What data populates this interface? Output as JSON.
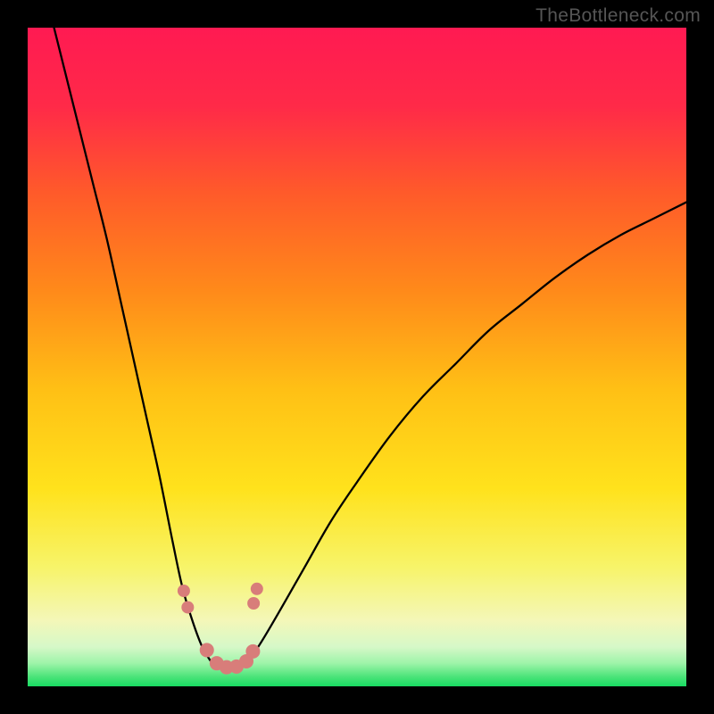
{
  "watermark": "TheBottleneck.com",
  "chart_data": {
    "type": "line",
    "title": "",
    "xlabel": "",
    "ylabel": "",
    "xlim": [
      0,
      100
    ],
    "ylim": [
      0,
      100
    ],
    "grid": false,
    "gradient": {
      "stops": [
        {
          "offset": 0.0,
          "color": "#ff1a52"
        },
        {
          "offset": 0.12,
          "color": "#ff2a48"
        },
        {
          "offset": 0.25,
          "color": "#ff5a2a"
        },
        {
          "offset": 0.4,
          "color": "#ff8a1a"
        },
        {
          "offset": 0.55,
          "color": "#ffc015"
        },
        {
          "offset": 0.7,
          "color": "#ffe21c"
        },
        {
          "offset": 0.82,
          "color": "#f7f46a"
        },
        {
          "offset": 0.9,
          "color": "#f4f7b8"
        },
        {
          "offset": 0.94,
          "color": "#d6f8c8"
        },
        {
          "offset": 0.965,
          "color": "#9ef4a9"
        },
        {
          "offset": 0.985,
          "color": "#4de47a"
        },
        {
          "offset": 1.0,
          "color": "#18db62"
        }
      ]
    },
    "series": [
      {
        "name": "left-branch",
        "x": [
          4,
          6,
          8,
          10,
          12,
          14,
          16,
          18,
          20,
          22,
          23.5,
          25,
          26.5,
          28
        ],
        "y": [
          100,
          92,
          84,
          76,
          68,
          59,
          50,
          41,
          32,
          22,
          15,
          10,
          6,
          3.5
        ]
      },
      {
        "name": "right-branch",
        "x": [
          33,
          35,
          38,
          42,
          46,
          50,
          55,
          60,
          65,
          70,
          75,
          80,
          85,
          90,
          95,
          100
        ],
        "y": [
          3.5,
          6,
          11,
          18,
          25,
          31,
          38,
          44,
          49,
          54,
          58,
          62,
          65.5,
          68.5,
          71,
          73.5
        ]
      },
      {
        "name": "valley-floor",
        "x": [
          28,
          29.5,
          31,
          32,
          33
        ],
        "y": [
          3.5,
          2.8,
          2.6,
          2.8,
          3.5
        ]
      }
    ],
    "markers": {
      "name": "valley-dots",
      "color": "#d87d7a",
      "points": [
        {
          "x": 23.7,
          "y": 14.5,
          "r": 7
        },
        {
          "x": 24.3,
          "y": 12.0,
          "r": 7
        },
        {
          "x": 27.2,
          "y": 5.5,
          "r": 8
        },
        {
          "x": 28.7,
          "y": 3.5,
          "r": 8
        },
        {
          "x": 30.2,
          "y": 2.9,
          "r": 8
        },
        {
          "x": 31.7,
          "y": 3.0,
          "r": 8
        },
        {
          "x": 33.2,
          "y": 3.8,
          "r": 8
        },
        {
          "x": 34.2,
          "y": 5.3,
          "r": 8
        },
        {
          "x": 34.3,
          "y": 12.6,
          "r": 7
        },
        {
          "x": 34.8,
          "y": 14.8,
          "r": 7
        }
      ]
    }
  }
}
